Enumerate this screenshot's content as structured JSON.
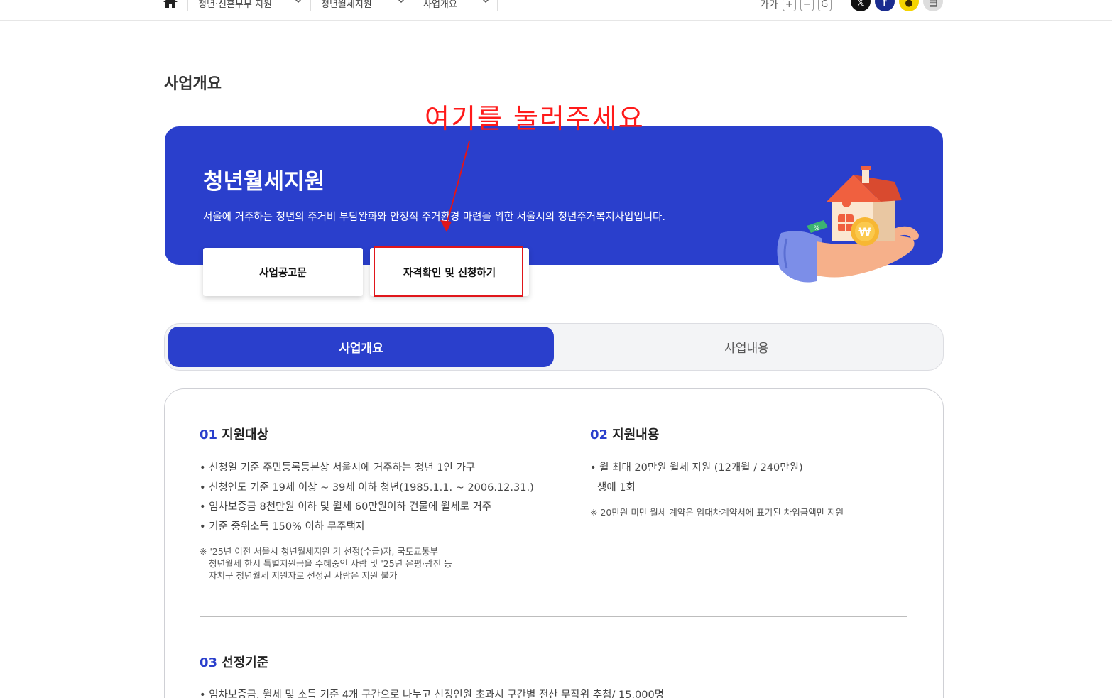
{
  "topbar": {
    "breadcrumbs": [
      {
        "label": "청년·신혼부부 지원"
      },
      {
        "label": "청년월세지원"
      },
      {
        "label": "사업개요"
      }
    ],
    "font_size_label": "가가",
    "plus_label": "+",
    "minus_label": "−",
    "refresh_label": "G",
    "share_icons": [
      "x-icon",
      "facebook-icon",
      "kakao-icon",
      "print-icon"
    ]
  },
  "page_title": "사업개요",
  "annotation_text": "여기를 눌러주세요",
  "hero": {
    "title": "청년월세지원",
    "description": "서울에 거주하는 청년의 주거비 부담완화와 안정적 주거환경 마련을 위한 서울시의 청년주거복지사업입니다.",
    "buttons": {
      "notice": "사업공고문",
      "apply": "자격확인 및 신청하기"
    },
    "bg_color": "#2a3fcc"
  },
  "tabs": {
    "overview": "사업개요",
    "content": "사업내용"
  },
  "sections": {
    "target": {
      "num": "01",
      "title": "지원대상",
      "items": [
        "• 신청일 기준 주민등록등본상 서울시에 거주하는 청년 1인 가구",
        "• 신청연도 기준 19세 이상 ~ 39세 이하 청년(1985.1.1. ~ 2006.12.31.)",
        "• 임차보증금 8천만원 이하 및 월세 60만원이하 건물에 월세로 거주",
        "• 기준 중위소득 150% 이하 무주택자"
      ],
      "notes": [
        "※ '25년 이전 서울시 청년월세지원 기 선정(수급)자, 국토교통부",
        "청년월세 한시 특별지원금을 수혜중인 사람 및 '25년 은평·광진 등",
        "자치구 청년월세 지원자로 선정된 사람은 지원 불가"
      ]
    },
    "support": {
      "num": "02",
      "title": "지원내용",
      "items": [
        "• 월 최대 20만원 월세 지원 (12개월 / 240만원)",
        "생애 1회"
      ],
      "note": "※ 20만원 미만 월세 계약은 임대차계약서에 표기된 차임금액만 지원"
    },
    "criteria": {
      "num": "03",
      "title": "선정기준",
      "items": [
        "• 임차보증금, 월세 및 소득 기준 4개 구간으로 나누고 선정인원 초과시 구간별 전산 무작위 추첨/ 15,000명"
      ]
    }
  }
}
